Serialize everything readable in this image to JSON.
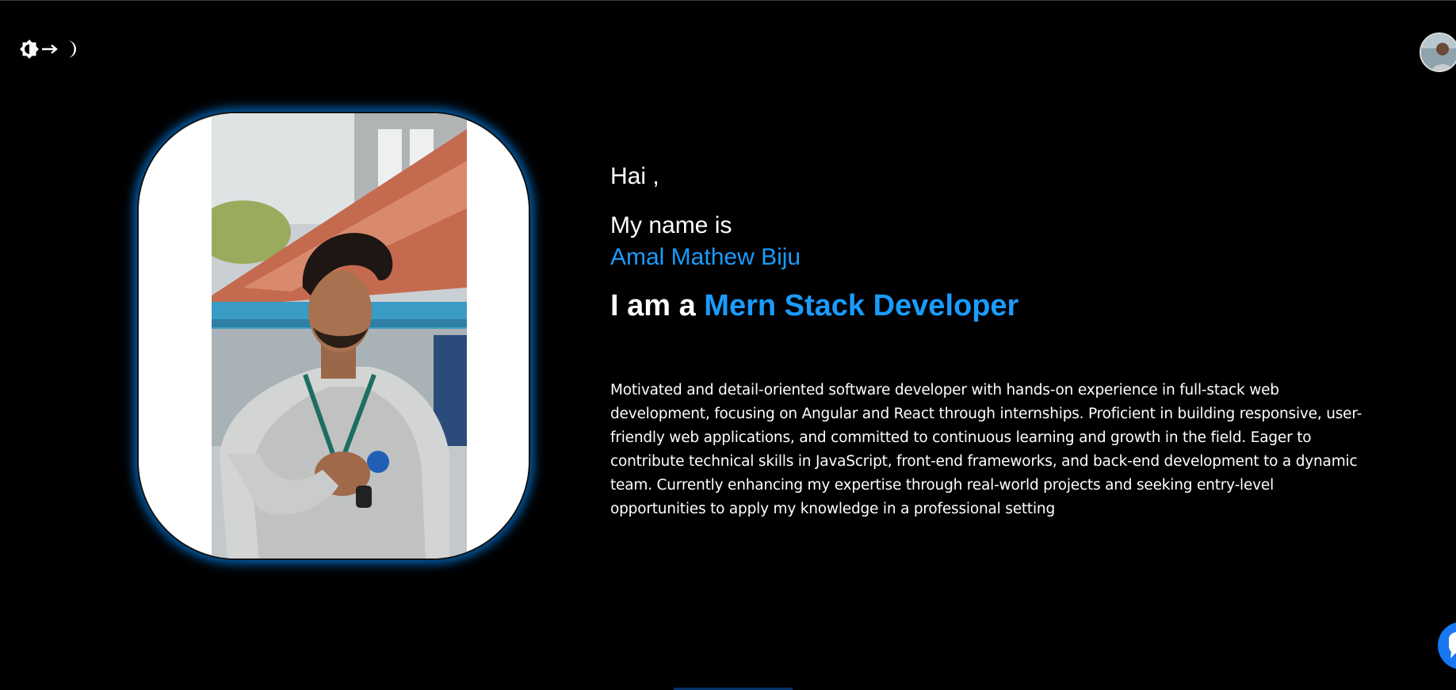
{
  "header": {
    "theme_toggle": {
      "icons": [
        "sun-icon",
        "arrow-right-icon",
        "moon-icon"
      ],
      "color": "#ffffff"
    },
    "avatar": {
      "icon": "profile-avatar"
    }
  },
  "hero": {
    "greeting": "Hai ,",
    "name_lead": "My name is",
    "name": "Amal Mathew Biju",
    "role_prefix": "I am a",
    "role": "Mern Stack Developer",
    "bio": "Motivated and detail-oriented software developer with hands-on experience in full-stack web development, focusing on Angular and React through internships. Proficient in building responsive, user-friendly web applications, and committed to continuous learning and growth in the field. Eager to contribute technical skills in JavaScript, front-end frameworks, and back-end development to a dynamic team. Currently enhancing my expertise through real-world projects and seeking entry-level opportunities to apply my knowledge in a professional setting"
  },
  "colors": {
    "background": "#000000",
    "accent": "#1a9cff",
    "glow": "#008cff",
    "chat_button": "#1877f2"
  },
  "chat": {
    "icon": "chat-icon"
  }
}
